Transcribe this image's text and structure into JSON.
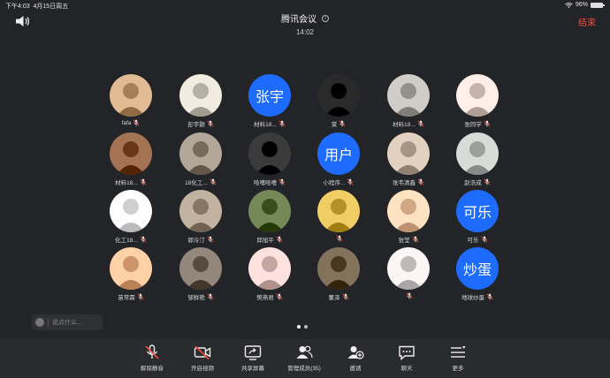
{
  "status_bar": {
    "time": "下午4:03",
    "date": "4月15日周五",
    "battery": "96%",
    "battery_level": 0.96
  },
  "header": {
    "title": "腾讯会议",
    "duration": "14:02",
    "end_label": "结束"
  },
  "colors": {
    "accent_blue": "#1e6bff",
    "end_red": "#f04b3c",
    "background": "#232427"
  },
  "participants": [
    {
      "name": "fafa",
      "avatar": "photo-girl",
      "color": "#c8a27a"
    },
    {
      "name": "彭宇颢",
      "avatar": "photo-cartoon",
      "color": "#d9d2c7"
    },
    {
      "name": "材料18...",
      "avatar_text": "张宇"
    },
    {
      "name": "棠",
      "avatar": "photo-black",
      "color": "#111111"
    },
    {
      "name": "材料18...",
      "avatar": "photo-girl2",
      "color": "#b7b3ae"
    },
    {
      "name": "张同学",
      "avatar": "photo-anime",
      "color": "#e9d6cf"
    },
    {
      "name": "材料18...",
      "avatar": "photo-dog",
      "color": "#8a5a3a"
    },
    {
      "name": "18化工...",
      "avatar": "photo-person",
      "color": "#9a8e80"
    },
    {
      "name": "哈嗜哈嗜",
      "avatar": "photo-anime-dark",
      "color": "#222222"
    },
    {
      "name": "小程序...",
      "avatar_text": "用户"
    },
    {
      "name": "张韦清鑫",
      "avatar": "photo-group",
      "color": "#c9b8a7"
    },
    {
      "name": "赵浩成",
      "avatar": "photo-landscape",
      "color": "#bfc3bf"
    },
    {
      "name": "化工18...",
      "avatar": "photo-bunny",
      "color": "#f2f2f2"
    },
    {
      "name": "郭泠汀",
      "avatar": "photo-man",
      "color": "#a89a86"
    },
    {
      "name": "邱旭平",
      "avatar": "photo-green",
      "color": "#5c6f3e"
    },
    {
      "name": "",
      "avatar": "photo-duck",
      "color": "#d8b54a"
    },
    {
      "name": "张莹",
      "avatar": "photo-cat",
      "color": "#f4c9a8"
    },
    {
      "name": "可乐",
      "avatar_text": "可乐"
    },
    {
      "name": "苗常霖",
      "avatar": "photo-cat2",
      "color": "#f1b88e"
    },
    {
      "name": "邹鲜艳",
      "avatar": "photo-girl3",
      "color": "#7a6e63"
    },
    {
      "name": "樊燕君",
      "avatar": "photo-couple",
      "color": "#e8c9c4"
    },
    {
      "name": "董泽",
      "avatar": "photo-toy",
      "color": "#6a5a44"
    },
    {
      "name": "",
      "avatar": "photo-girl4",
      "color": "#e3dcdc"
    },
    {
      "name": "地球炒蛋",
      "avatar_text": "炒蛋"
    }
  ],
  "chat": {
    "placeholder": "说点什么..."
  },
  "toolbar": {
    "items": [
      {
        "label": "解除静音",
        "icon": "mic-muted-icon"
      },
      {
        "label": "开启视频",
        "icon": "camera-off-icon"
      },
      {
        "label": "共享屏幕",
        "icon": "share-screen-icon"
      },
      {
        "label": "管理成员(35)",
        "icon": "members-icon"
      },
      {
        "label": "邀请",
        "icon": "invite-icon"
      },
      {
        "label": "聊天",
        "icon": "chat-icon"
      },
      {
        "label": "更多",
        "icon": "more-icon"
      }
    ]
  }
}
